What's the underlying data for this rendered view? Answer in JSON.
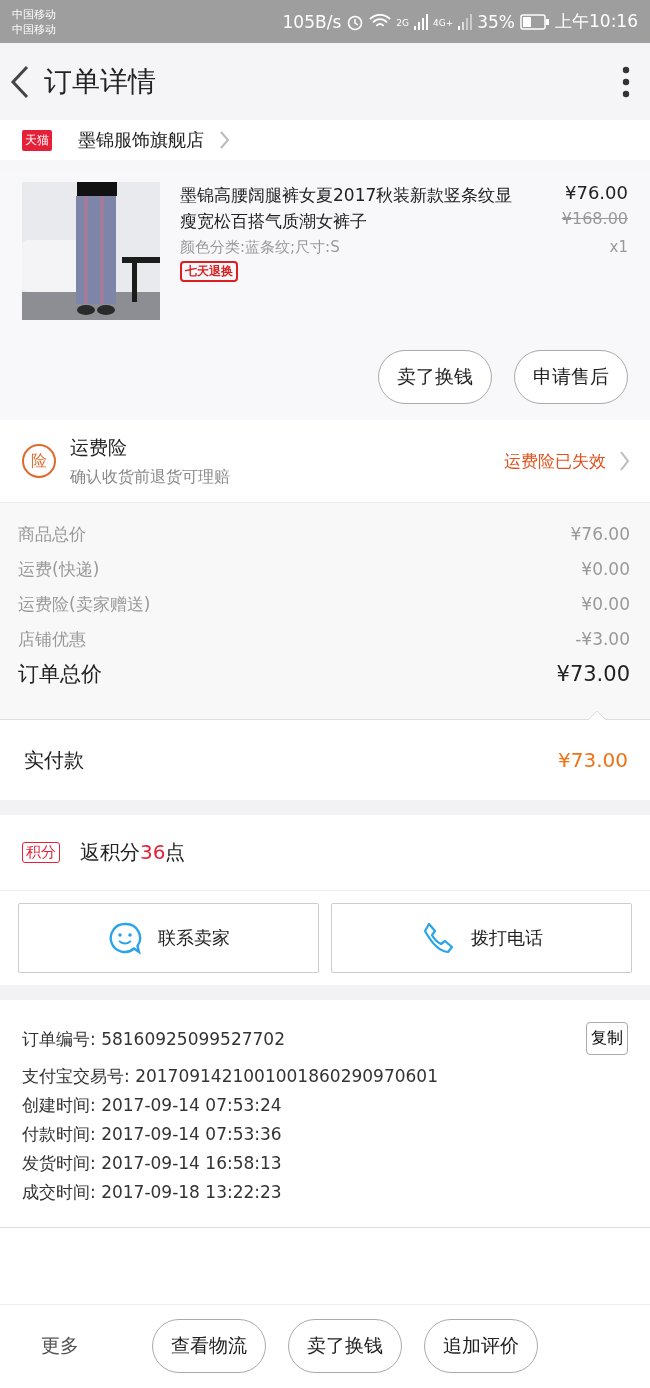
{
  "status_bar": {
    "carriers": [
      "中国移动",
      "中国移动"
    ],
    "speed": "105B/s",
    "network_labels": [
      "2G",
      "4G+"
    ],
    "battery": "35%",
    "time": "上午10:16"
  },
  "header": {
    "title": "订单详情"
  },
  "shop": {
    "badge": "天猫",
    "name": "墨锦服饰旗舰店"
  },
  "product": {
    "title": "墨锦高腰阔腿裤女夏2017秋装新款竖条纹显瘦宽松百搭气质潮女裤子",
    "sku": "颜色分类:蓝条纹;尺寸:S",
    "tag": "七天退换",
    "price": "¥76.00",
    "original_price": "¥168.00",
    "quantity": "x1",
    "buttons": [
      "卖了换钱",
      "申请售后"
    ]
  },
  "insurance": {
    "icon_label": "险",
    "title": "运费险",
    "subtitle": "确认收货前退货可理赔",
    "status": "运费险已失效"
  },
  "costs": [
    {
      "label": "商品总价",
      "value": "¥76.00",
      "kind": "item"
    },
    {
      "label": "运费(快递)",
      "value": "¥0.00",
      "kind": "item"
    },
    {
      "label": "运费险(卖家赠送)",
      "value": "¥0.00",
      "kind": "item"
    },
    {
      "label": "店铺优惠",
      "value": "-¥3.00",
      "kind": "item"
    },
    {
      "label": "订单总价",
      "value": "¥73.00",
      "kind": "total"
    }
  ],
  "paid": {
    "label": "实付款",
    "value": "¥73.00"
  },
  "points": {
    "badge": "积分",
    "prefix": "返积分",
    "amount": "36",
    "suffix": "点"
  },
  "contact_buttons": [
    {
      "label": "联系卖家",
      "kind": "chat"
    },
    {
      "label": "拨打电话",
      "kind": "phone"
    }
  ],
  "order_info": {
    "copy_button": "复制",
    "lines": [
      "订单编号: 58160925099527702",
      "支付宝交易号: 2017091421001001860290970601",
      "创建时间: 2017-09-14 07:53:24",
      "付款时间: 2017-09-14 07:53:36",
      "发货时间: 2017-09-14 16:58:13",
      "成交时间: 2017-09-18 13:22:23"
    ]
  },
  "bottom_bar": {
    "more": "更多",
    "buttons": [
      "查看物流",
      "卖了换钱",
      "追加评价"
    ]
  }
}
